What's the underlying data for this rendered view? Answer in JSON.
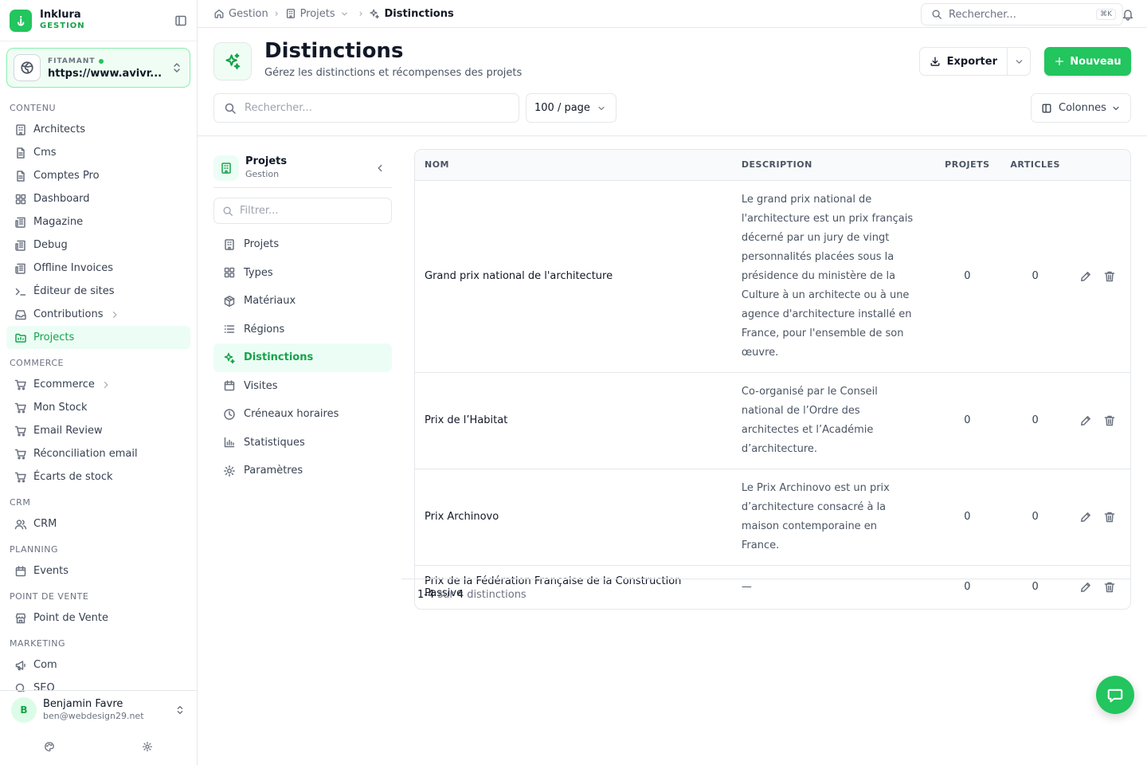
{
  "brand": {
    "name": "Inklura",
    "sub": "GESTION",
    "accent": "#22c55e"
  },
  "site": {
    "label": "FITAMANT",
    "url": "https://www.avivr..."
  },
  "nav_sections": [
    {
      "label": "CONTENU",
      "items": [
        {
          "label": "Architects",
          "icon": "building-icon"
        },
        {
          "label": "Cms",
          "icon": "document-icon"
        },
        {
          "label": "Comptes Pro",
          "icon": "document-icon"
        },
        {
          "label": "Dashboard",
          "icon": "grid-icon"
        },
        {
          "label": "Magazine",
          "icon": "newspaper-icon"
        },
        {
          "label": "Debug",
          "icon": "newspaper-icon"
        },
        {
          "label": "Offline Invoices",
          "icon": "newspaper-icon"
        },
        {
          "label": "Éditeur de sites",
          "icon": "terminal-icon"
        },
        {
          "label": "Contributions",
          "icon": "inbox-icon",
          "sub": true
        },
        {
          "label": "Projects",
          "icon": "folder-icon",
          "active": true
        }
      ]
    },
    {
      "label": "COMMERCE",
      "items": [
        {
          "label": "Ecommerce",
          "icon": "cart-icon",
          "sub": true
        },
        {
          "label": "Mon Stock",
          "icon": "cart-icon"
        },
        {
          "label": "Email Review",
          "icon": "cart-icon"
        },
        {
          "label": "Réconciliation email",
          "icon": "cart-icon"
        },
        {
          "label": "Écarts de stock",
          "icon": "cart-icon"
        }
      ]
    },
    {
      "label": "CRM",
      "items": [
        {
          "label": "CRM",
          "icon": "users-icon"
        }
      ]
    },
    {
      "label": "PLANNING",
      "items": [
        {
          "label": "Events",
          "icon": "calendar-icon"
        }
      ]
    },
    {
      "label": "POINT DE VENTE",
      "items": [
        {
          "label": "Point de Vente",
          "icon": "store-icon"
        }
      ]
    },
    {
      "label": "MARKETING",
      "items": [
        {
          "label": "Com",
          "icon": "megaphone-icon"
        },
        {
          "label": "SEO",
          "icon": "search-icon"
        }
      ]
    }
  ],
  "user": {
    "initial": "B",
    "name": "Benjamin Favre",
    "email": "ben@webdesign29.net"
  },
  "breadcrumb": [
    {
      "label": "Gestion",
      "icon": "home-icon"
    },
    {
      "label": "Projets",
      "icon": "building-icon",
      "dropdown": true
    },
    {
      "label": "Distinctions",
      "icon": "sparkles-icon",
      "current": true
    }
  ],
  "top_search": {
    "placeholder": "Rechercher...",
    "shortcut": "⌘K"
  },
  "header": {
    "title": "Distinctions",
    "subtitle": "Gérez les distinctions et récompenses des projets",
    "export_label": "Exporter",
    "new_label": "Nouveau",
    "search_placeholder": "Rechercher...",
    "per_page": "100 / page",
    "columns_label": "Colonnes"
  },
  "subnav": {
    "title": "Projets",
    "subtitle": "Gestion",
    "filter_placeholder": "Filtrer...",
    "items": [
      {
        "label": "Projets",
        "icon": "building-icon"
      },
      {
        "label": "Types",
        "icon": "grid-icon"
      },
      {
        "label": "Matériaux",
        "icon": "box-icon"
      },
      {
        "label": "Régions",
        "icon": "list-icon"
      },
      {
        "label": "Distinctions",
        "icon": "sparkles-icon",
        "active": true
      },
      {
        "label": "Visites",
        "icon": "calendar-icon"
      },
      {
        "label": "Créneaux horaires",
        "icon": "clock-icon"
      },
      {
        "label": "Statistiques",
        "icon": "chart-icon"
      },
      {
        "label": "Paramètres",
        "icon": "gear-icon"
      }
    ]
  },
  "table": {
    "columns": [
      "NOM",
      "DESCRIPTION",
      "PROJETS",
      "ARTICLES"
    ],
    "rows": [
      {
        "name": "Grand prix national de l'architecture",
        "description": "Le grand prix national de l'architecture est un prix français décerné par un jury de vingt personnalités placées sous la présidence du ministère de la Culture à un architecte ou à une agence d'architecture installé en France, pour l'ensemble de son œuvre.",
        "projets": "0",
        "articles": "0"
      },
      {
        "name": "Prix de l’Habitat",
        "description": "Co-organisé par le Conseil national de l’Ordre des architectes et l’Académie d’architecture.",
        "projets": "0",
        "articles": "0"
      },
      {
        "name": "Prix Archinovo",
        "description": "Le Prix Archinovo est un prix d’architecture consacré à la maison contemporaine en France.",
        "projets": "0",
        "articles": "0"
      },
      {
        "name": "Prix de la Fédération Française de la Construction Passive",
        "description": "—",
        "projets": "0",
        "articles": "0"
      }
    ]
  },
  "pagination": {
    "range": "1-4",
    "sur": "sur",
    "total": "4",
    "unit": "distinctions"
  }
}
